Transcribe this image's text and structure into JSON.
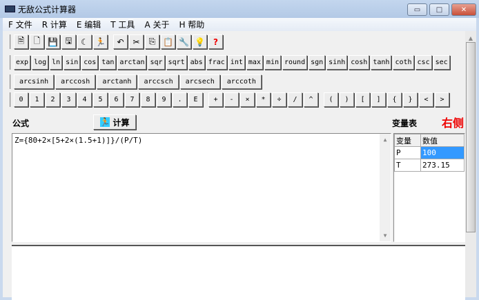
{
  "window": {
    "title": "无敌公式计算器",
    "minimize": "▭",
    "maximize": "□",
    "close": "✕"
  },
  "menu": [
    "F 文件",
    "R 计算",
    "E 编辑",
    "T 工具",
    "A 关于",
    "H 帮助"
  ],
  "toolbar": [
    {
      "name": "new-file-icon",
      "glyph": "🗎"
    },
    {
      "name": "blank-file-icon",
      "glyph": "🗋"
    },
    {
      "name": "save-icon",
      "glyph": "💾"
    },
    {
      "name": "save-as-icon",
      "glyph": "🖫"
    },
    {
      "name": "moon-icon",
      "glyph": "☾"
    },
    {
      "name": "run-icon",
      "glyph": "🏃"
    },
    {
      "name": "undo-icon",
      "glyph": "↶"
    },
    {
      "name": "cut-icon",
      "glyph": "✂"
    },
    {
      "name": "copy-icon",
      "glyph": "⎘"
    },
    {
      "name": "paste-icon",
      "glyph": "📋"
    },
    {
      "name": "tools-icon",
      "glyph": "🔧"
    },
    {
      "name": "tip-icon",
      "glyph": "💡"
    },
    {
      "name": "help-icon",
      "glyph": "?"
    }
  ],
  "functions": [
    "exp",
    "log",
    "ln",
    "sin",
    "cos",
    "tan",
    "arctan",
    "sqr",
    "sqrt",
    "abs",
    "frac",
    "int",
    "max",
    "min",
    "round",
    "sgn",
    "sinh",
    "cosh",
    "tanh",
    "coth",
    "csc",
    "sec"
  ],
  "functions2": [
    "arcsinh",
    "arccosh",
    "arctanh",
    "arccsch",
    "arcsech",
    "arccoth"
  ],
  "digits": [
    "0",
    "1",
    "2",
    "3",
    "4",
    "5",
    "6",
    "7",
    "8",
    "9",
    ".",
    "E"
  ],
  "operators": [
    "+",
    "-",
    "×",
    "*",
    "÷",
    "/",
    "^"
  ],
  "brackets": [
    "(",
    ")",
    "[",
    "]",
    "{",
    "}",
    "<",
    ">"
  ],
  "formula_label": "公式",
  "calc_button": "计算",
  "var_label": "变量表",
  "right_label": "右侧",
  "formula": "Z={80+2×[5+2×(1.5+1)]}/(P/T)",
  "vars": {
    "headers": [
      "变量",
      "数值"
    ],
    "rows": [
      [
        "P",
        "100"
      ],
      [
        "T",
        "273.15"
      ]
    ]
  }
}
